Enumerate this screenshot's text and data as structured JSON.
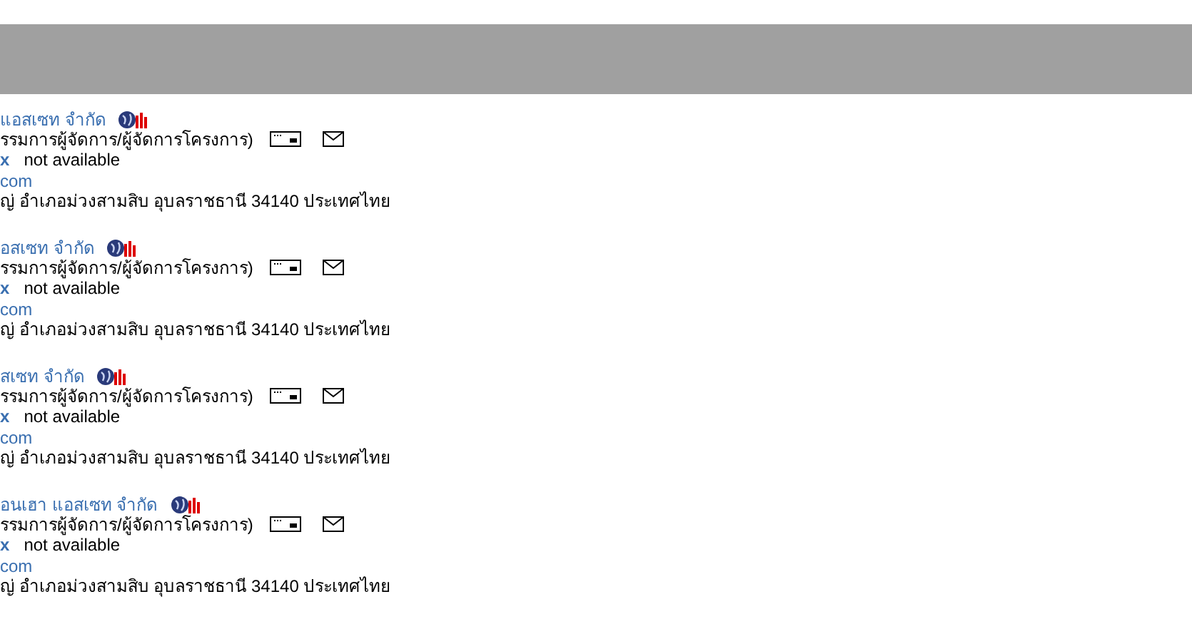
{
  "entries": [
    {
      "company": "แอสเซท จำกัด",
      "position": "รรมการผู้จัดการ/ผู้จัดการโครงการ)",
      "fax_label": "x",
      "fax_value": "not available",
      "web": "com",
      "address": "ญ่ อำเภอม่วงสามสิบ อุบลราชธานี 34140 ประเทศไทย"
    },
    {
      "company": "อสเซท จำกัด",
      "position": "รรมการผู้จัดการ/ผู้จัดการโครงการ)",
      "fax_label": "x",
      "fax_value": "not available",
      "web": "com",
      "address": "ญ่ อำเภอม่วงสามสิบ อุบลราชธานี 34140 ประเทศไทย"
    },
    {
      "company": "สเซท จำกัด",
      "position": "รรมการผู้จัดการ/ผู้จัดการโครงการ)",
      "fax_label": "x",
      "fax_value": "not available",
      "web": "com",
      "address": "ญ่ อำเภอม่วงสามสิบ อุบลราชธานี 34140 ประเทศไทย"
    },
    {
      "company": "อนเฮา แอสเซท จำกัด",
      "position": "รรมการผู้จัดการ/ผู้จัดการโครงการ)",
      "fax_label": "x",
      "fax_value": "not available",
      "web": "com",
      "address": "ญ่ อำเภอม่วงสามสิบ อุบลราชธานี 34140 ประเทศไทย"
    }
  ]
}
